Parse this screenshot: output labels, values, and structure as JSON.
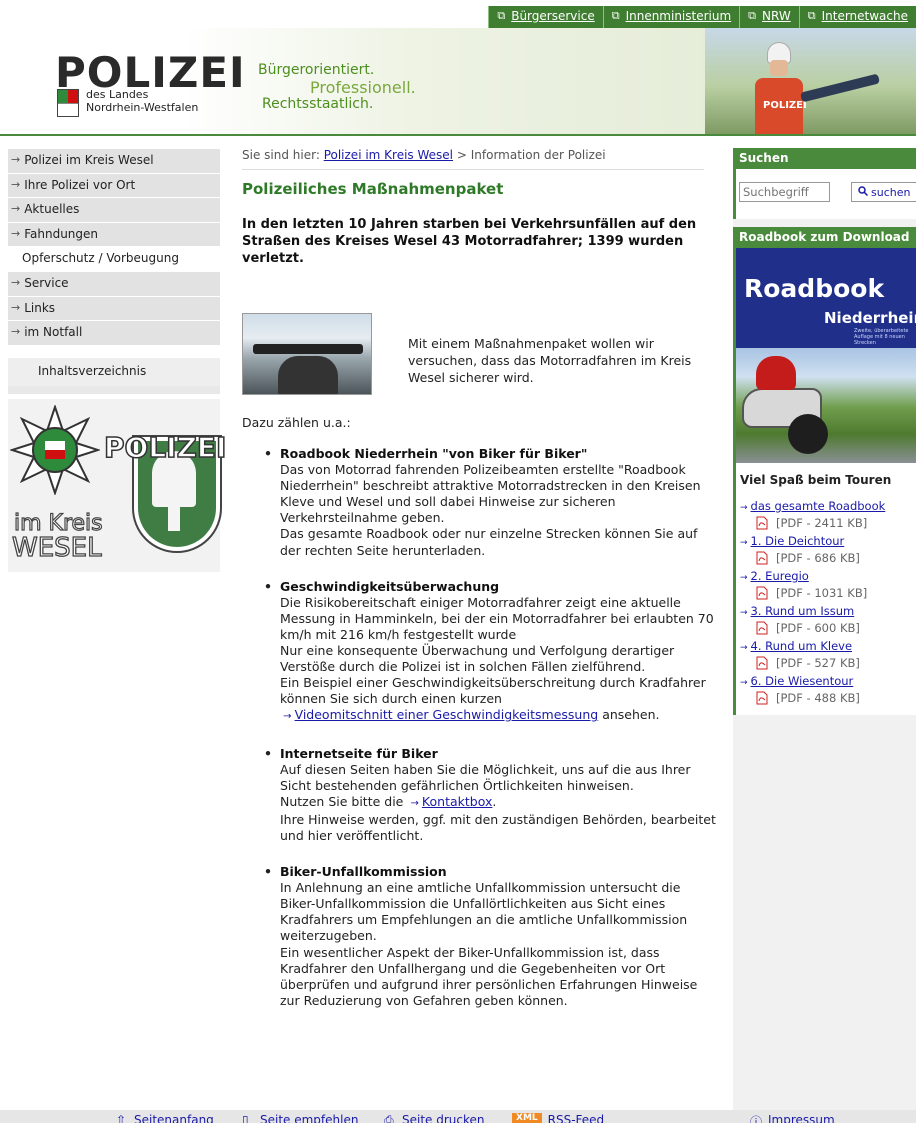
{
  "top_links": [
    {
      "label": "Bürgerservice"
    },
    {
      "label": "Innenministerium"
    },
    {
      "label": "NRW"
    },
    {
      "label": "Internetwache"
    }
  ],
  "header": {
    "logo_word": "POLIZEI",
    "logo_sub1": "des Landes",
    "logo_sub2": "Nordrhein-Westfalen",
    "slogan1": "Bürgerorientiert.",
    "slogan2": "Professionell.",
    "slogan3": "Rechtsstaatlich.",
    "photo_vest_text": "POLIZEI"
  },
  "sidebar": {
    "items": [
      {
        "label": "Polizei im Kreis Wesel"
      },
      {
        "label": "Ihre Polizei vor Ort"
      },
      {
        "label": "Aktuelles"
      },
      {
        "label": "Fahndungen"
      },
      {
        "label": "Opferschutz / Vorbeugung"
      },
      {
        "label": "Service"
      },
      {
        "label": "Links"
      },
      {
        "label": "im Notfall"
      }
    ],
    "index_label": "Inhaltsverzeichnis",
    "crest": {
      "polizei": "POLIZEI",
      "im_kreis": "im Kreis",
      "wesel": "WESEL"
    }
  },
  "breadcrumb": {
    "prefix": "Sie sind hier:",
    "link": "Polizei im Kreis Wesel",
    "sep": ">",
    "current": "Information der Polizei"
  },
  "main": {
    "title": "Polizeiliches Maßnahmenpaket",
    "lead": "In den letzten 10 Jahren starben bei Verkehrsunfällen auf den Straßen des Kreises Wesel 43 Motorradfahrer; 1399 wurden verletzt.",
    "intro": "Mit einem Maßnahmenpaket wollen wir versuchen, dass das Motorradfahren im Kreis Wesel sicherer wird.",
    "dazu": "Dazu zählen u.a.:",
    "items": [
      {
        "title": "Roadbook Niederrhein \"von Biker für Biker\"",
        "text": "Das von Motorrad fahrenden Polizeibeamten erstellte \"Roadbook Niederrhein\" beschreibt attraktive Motorradstrecken in den Kreisen Kleve und Wesel und soll dabei Hinweise zur sicheren Verkehrsteilnahme geben.",
        "text2": "Das gesamte Roadbook oder nur einzelne Strecken können Sie auf der rechten Seite herunterladen."
      },
      {
        "title": "Geschwindigkeitsüberwachung",
        "text": "Die Risikobereitschaft einiger Motorradfahrer zeigt eine aktuelle Messung in Hamminkeln, bei der ein Motorradfahrer bei erlaubten 70 km/h mit 216 km/h festgestellt wurde",
        "text2": "Nur eine konsequente Überwachung und Verfolgung derartiger Verstöße durch die Polizei ist in solchen Fällen zielführend.",
        "text3": "Ein Beispiel einer Geschwindigkeitsüberschreitung durch Kradfahrer können Sie sich durch einen kurzen",
        "link": "Videomitschnitt einer Geschwindigkeitsmessung",
        "after_link": "ansehen."
      },
      {
        "title": "Internetseite für Biker",
        "text": "Auf diesen Seiten haben Sie die Möglichkeit, uns auf die aus Ihrer Sicht bestehenden gefährlichen Örtlichkeiten hinweisen.",
        "pre_link": "Nutzen Sie bitte die",
        "link": "Kontaktbox",
        "after_link": ".",
        "text2": "Ihre Hinweise werden, ggf. mit den zuständigen Behörden, bearbeitet und hier veröffentlicht."
      },
      {
        "title": "Biker-Unfallkommission",
        "text": "In Anlehnung an eine amtliche Unfallkommission untersucht die Biker-Unfallkommission die Unfallörtlichkeiten aus Sicht eines Kradfahrers um Empfehlungen an die amtliche Unfallkommission weiterzugeben.",
        "text2": "Ein wesentlicher Aspekt der Biker-Unfallkommission ist, dass Kradfahrer den Unfallhergang und die Gegebenheiten vor Ort überprüfen und aufgrund ihrer persönlichen Erfahrungen Hinweise zur Reduzierung von Gefahren geben können."
      }
    ]
  },
  "search": {
    "heading": "Suchen",
    "placeholder": "Suchbegriff",
    "button": "suchen"
  },
  "roadbook": {
    "heading": "Roadbook zum Download",
    "title": "Roadbook",
    "subtitle": "Niederrhein",
    "small": "Zweite, überarbeitete Auflage mit 8 neuen Strecken",
    "tour_heading": "Viel Spaß beim Touren",
    "tours": [
      {
        "label": "das gesamte Roadbook",
        "file": "[PDF - 2411 KB]"
      },
      {
        "label": "1. Die Deichtour",
        "file": "[PDF - 686 KB]"
      },
      {
        "label": "2. Euregio",
        "file": "[PDF - 1031 KB]"
      },
      {
        "label": "3. Rund um Issum",
        "file": "[PDF - 600 KB]"
      },
      {
        "label": "4. Rund um Kleve",
        "file": "[PDF - 527 KB]"
      },
      {
        "label": "6. Die Wiesentour",
        "file": "[PDF - 488 KB]"
      }
    ]
  },
  "footer": {
    "top": "Seitenanfang",
    "recommend": "Seite empfehlen",
    "print": "Seite drucken",
    "rss_badge": "XML",
    "rss": "RSS-Feed",
    "imprint": "Impressum"
  },
  "colors": {
    "brand_green": "#4a8a3c",
    "title_green": "#2f7a28",
    "link_blue": "#1a1aa8"
  }
}
